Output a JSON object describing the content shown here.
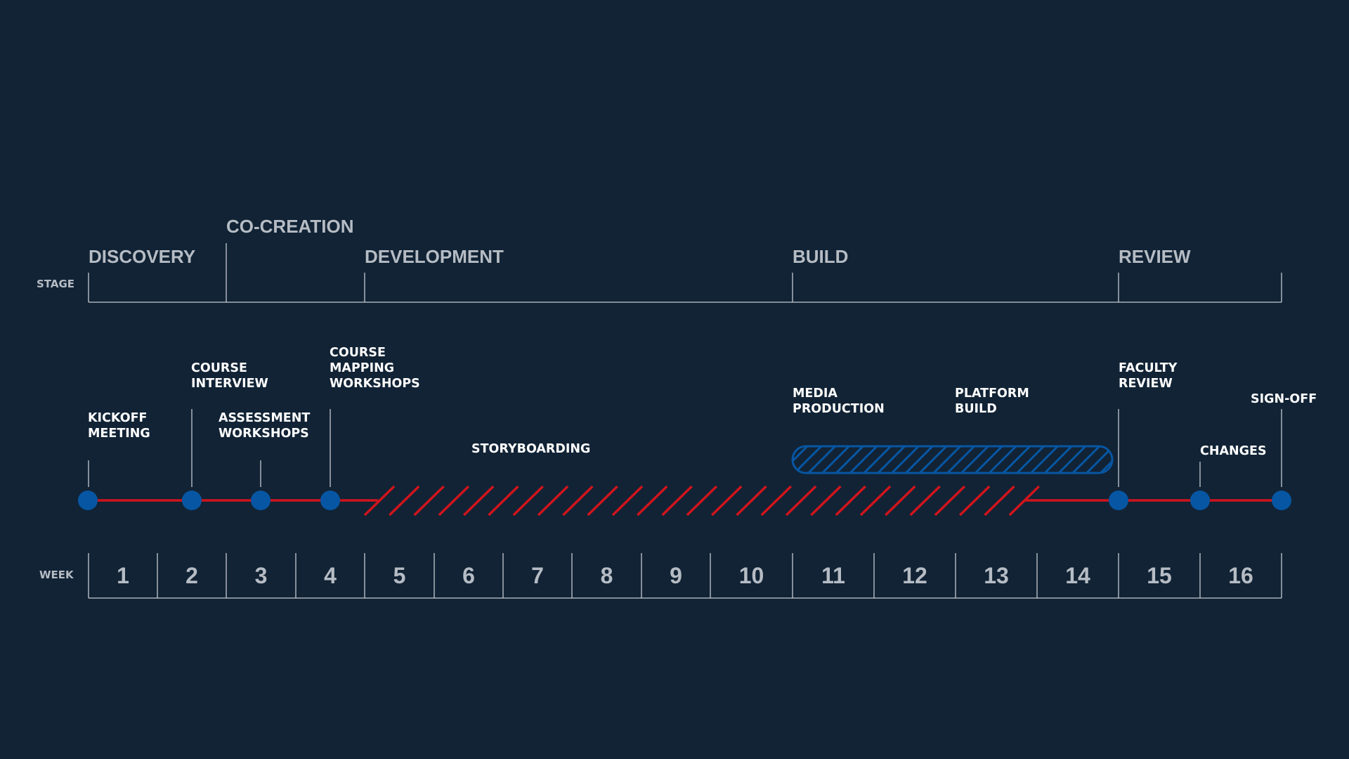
{
  "row_labels": {
    "stage": "STAGE",
    "week": "WEEK"
  },
  "stages": [
    {
      "name": "DISCOVERY"
    },
    {
      "name": "CO-CREATION"
    },
    {
      "name": "DEVELOPMENT"
    },
    {
      "name": "BUILD"
    },
    {
      "name": "REVIEW"
    }
  ],
  "weeks": [
    "1",
    "2",
    "3",
    "4",
    "5",
    "6",
    "7",
    "8",
    "9",
    "10",
    "11",
    "12",
    "13",
    "14",
    "15",
    "16"
  ],
  "milestones": [
    {
      "id": "kickoff",
      "lines": [
        "KICKOFF",
        "MEETING"
      ]
    },
    {
      "id": "course-interview",
      "lines": [
        "COURSE",
        "INTERVIEW"
      ]
    },
    {
      "id": "assessment-workshops",
      "lines": [
        "ASSESSMENT",
        "WORKSHOPS"
      ]
    },
    {
      "id": "course-mapping-workshops",
      "lines": [
        "COURSE",
        "MAPPING",
        "WORKSHOPS"
      ]
    },
    {
      "id": "faculty-review",
      "lines": [
        "FACULTY",
        "REVIEW"
      ]
    },
    {
      "id": "changes",
      "lines": [
        "CHANGES"
      ]
    },
    {
      "id": "sign-off",
      "lines": [
        "SIGN-OFF"
      ]
    }
  ],
  "tasks": [
    {
      "id": "storyboarding",
      "lines": [
        "STORYBOARDING"
      ]
    },
    {
      "id": "media-production",
      "lines": [
        "MEDIA",
        "PRODUCTION"
      ]
    },
    {
      "id": "platform-build",
      "lines": [
        "PLATFORM",
        "BUILD"
      ]
    }
  ],
  "colors": {
    "background": "#112335",
    "timeline_red": "#d0141c",
    "milestone_blue": "#0756a3",
    "build_bar_blue": "#0756a3",
    "grid": "#c5cad0",
    "heading_text": "#b6bcc4",
    "label_text": "#ffffff"
  }
}
